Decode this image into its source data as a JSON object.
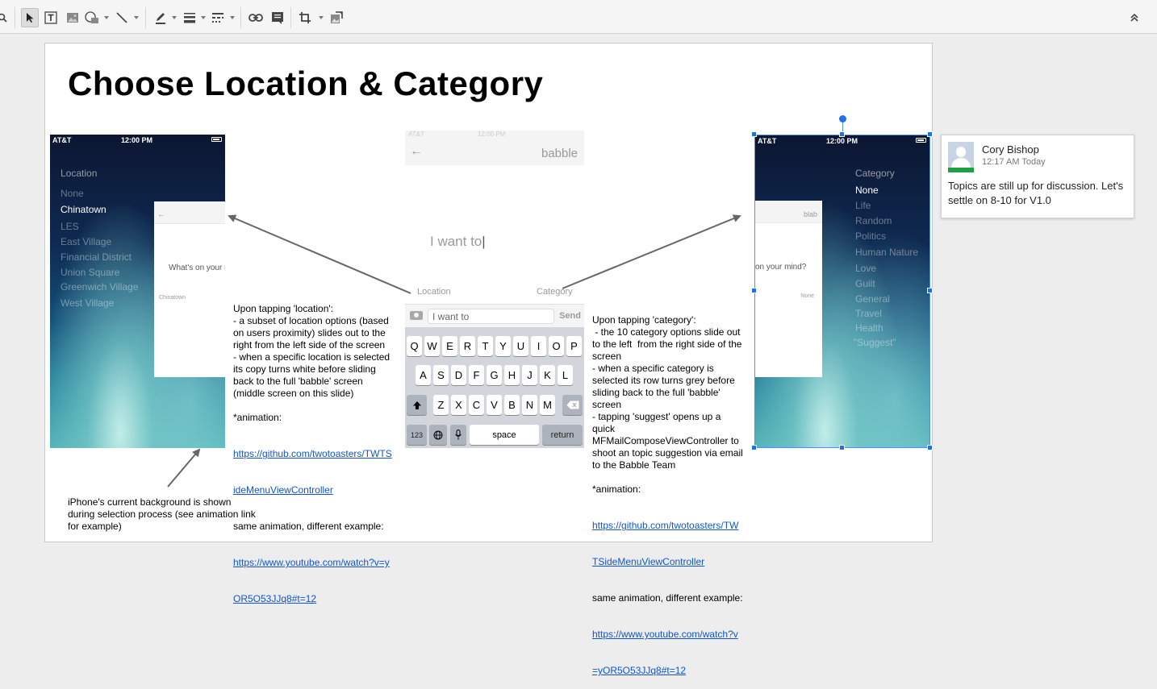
{
  "toolbar": {
    "tools": [
      "zoom",
      "select",
      "text-box",
      "image",
      "shape",
      "line",
      "pen",
      "line-weight",
      "line-dash",
      "link",
      "comment",
      "crop",
      "replace-image"
    ],
    "collapse_icon": "chevron-up-double"
  },
  "slide": {
    "title": "Choose Location & Category",
    "left_phone": {
      "carrier": "AT&T",
      "time": "12:00 PM",
      "menu_heading": "Location",
      "menu_items": [
        "None",
        "Chinatown",
        "LES",
        "East Village",
        "Financial District",
        "Union Square",
        "Greenwich Village",
        "West Village"
      ],
      "active_item": "Chinatown",
      "overlay_prompt": "What's on your r",
      "overlay_location": "Chinatown"
    },
    "middle_phone": {
      "faint_carrier": "AT&T",
      "faint_time": "12:00 PM",
      "back_icon": "arrow-left",
      "app_name": "babble",
      "placeholder": "I want to",
      "location_label": "Location",
      "category_label": "Category",
      "input_value": "I want to",
      "send_label": "Send",
      "keyboard": {
        "row1": [
          "Q",
          "W",
          "E",
          "R",
          "T",
          "Y",
          "U",
          "I",
          "O",
          "P"
        ],
        "row2": [
          "A",
          "S",
          "D",
          "F",
          "G",
          "H",
          "J",
          "K",
          "L"
        ],
        "row3": [
          "Z",
          "X",
          "C",
          "V",
          "B",
          "N",
          "M"
        ],
        "num_key": "123",
        "space_key": "space",
        "return_key": "return"
      }
    },
    "right_phone": {
      "carrier": "AT&T",
      "time": "12:00 PM",
      "menu_heading": "Category",
      "menu_items": [
        "None",
        "Life",
        "Random",
        "Politics",
        "Human Nature",
        "Love",
        "Guilt",
        "General",
        "Travel",
        "Health",
        "\"Suggest\""
      ],
      "active_item": "None",
      "overlay_app_name": "blab",
      "overlay_prompt": "on your mind?",
      "overlay_category": "None"
    },
    "location_note": {
      "text": "Upon tapping 'location':\n- a subset of location options (based\non users proximity) slides out to the\nright from the left side of the screen\n- when a specific location is selected\nits copy turns white before sliding\nback to the full 'babble' screen\n(middle screen on this slide)\n\n*animation:",
      "link1_line1": "https://github.com/twotoasters/TWTS",
      "link1_line2": "ideMenuViewController",
      "mid_text": "same animation, different example:",
      "link2_line1": "https://www.youtube.com/watch?v=y",
      "link2_line2": "OR5O53JJq8#t=12"
    },
    "category_note": {
      "text": "Upon tapping 'category':\n - the 10 category options slide out\nto the left  from the right side of the\nscreen\n- when a specific category is\nselected its row turns grey before\nsliding back to the full 'babble'\nscreen\n- tapping 'suggest' opens up a\nquick\nMFMailComposeViewController to\nshoot an topic suggestion via email\nto the Babble Team\n\n*animation:",
      "link1_line1": "https://github.com/twotoasters/TW",
      "link1_line2": "TSideMenuViewController",
      "mid_text": "same animation, different example:",
      "link2_line1": "https://www.youtube.com/watch?v",
      "link2_line2": "=yOR5O53JJq8#t=12"
    },
    "background_note": "iPhone's current background is shown\nduring selection process (see animation link\nfor example)"
  },
  "comment": {
    "author": "Cory Bishop",
    "time": "12:17 AM Today",
    "text": "Topics are still up for discussion. Let's settle on 8-10 for V1.0"
  },
  "colors": {
    "link": "#1155cc",
    "selection": "#4d90fe",
    "arrow": "#666666",
    "avatar_status": "#1e9e45"
  }
}
